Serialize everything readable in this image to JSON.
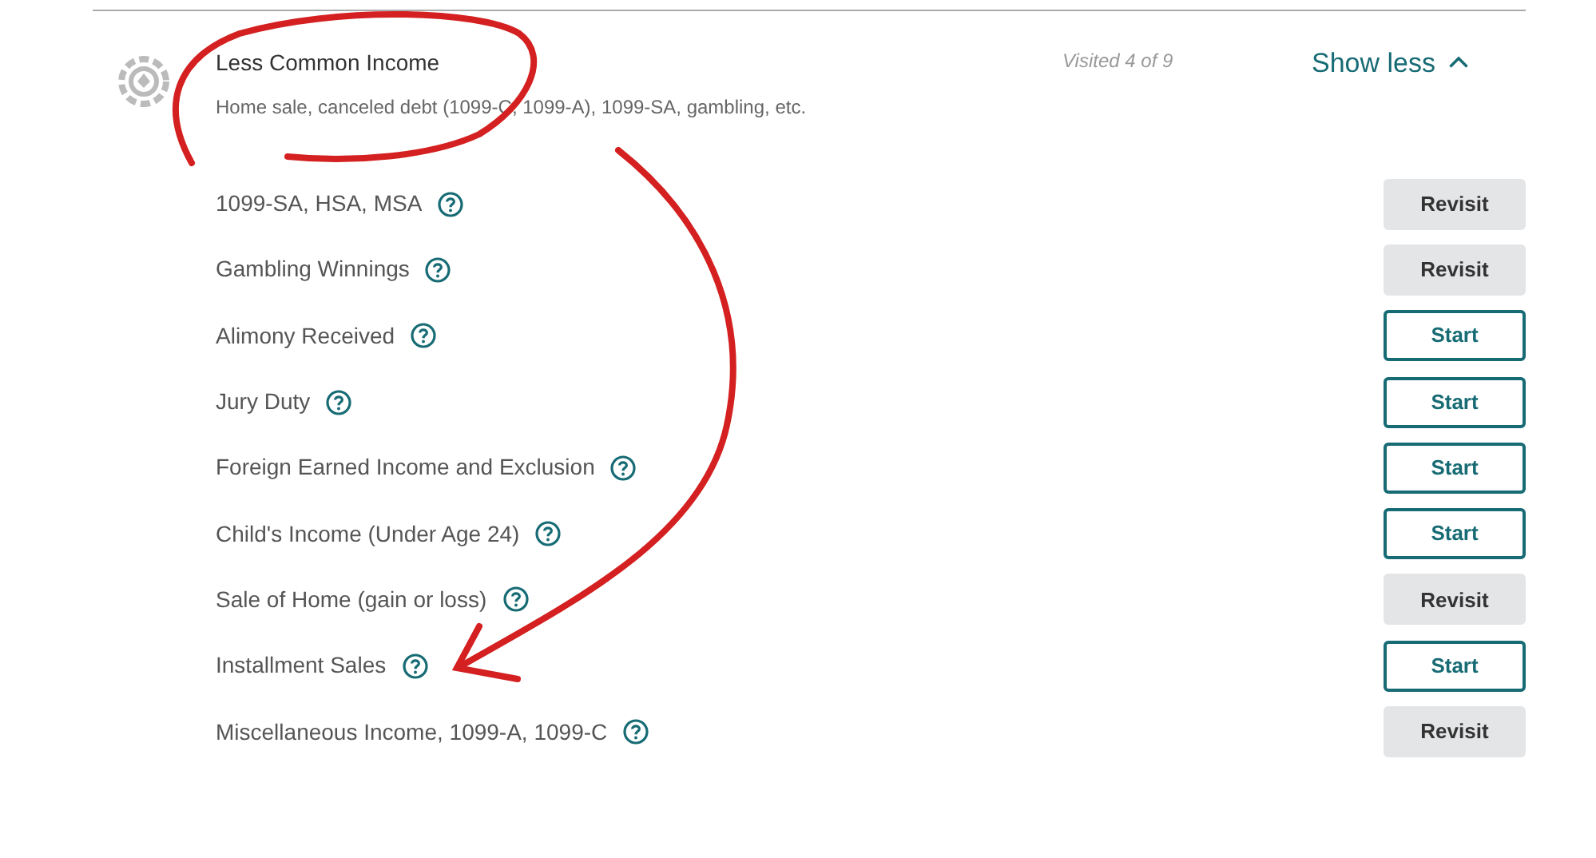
{
  "section": {
    "title": "Less Common Income",
    "subtitle": "Home sale, canceled debt (1099-C, 1099-A), 1099-SA, gambling, etc.",
    "progress": "Visited 4 of 9",
    "toggle": "Show less",
    "expanded": true
  },
  "items": [
    {
      "label": "1099-SA, HSA, MSA",
      "kind": "revisit",
      "action": "Revisit"
    },
    {
      "label": "Gambling Winnings",
      "kind": "revisit",
      "action": "Revisit"
    },
    {
      "label": "Alimony Received",
      "kind": "start",
      "action": "Start"
    },
    {
      "label": "Jury Duty",
      "kind": "start",
      "action": "Start"
    },
    {
      "label": "Foreign Earned Income and Exclusion",
      "kind": "start",
      "action": "Start"
    },
    {
      "label": "Child's Income (Under Age 24)",
      "kind": "start",
      "action": "Start"
    },
    {
      "label": "Sale of Home (gain or loss)",
      "kind": "revisit",
      "action": "Revisit"
    },
    {
      "label": "Installment Sales",
      "kind": "start",
      "action": "Start"
    },
    {
      "label": "Miscellaneous Income, 1099-A, 1099-C",
      "kind": "revisit",
      "action": "Revisit"
    }
  ]
}
